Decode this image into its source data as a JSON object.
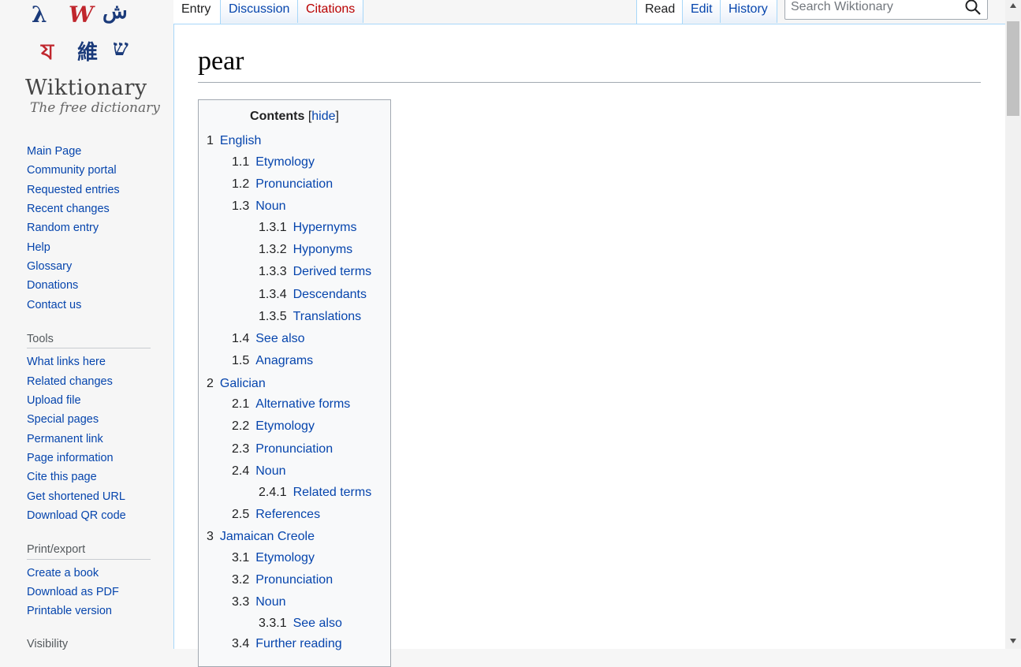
{
  "logo": {
    "glyphs": [
      "λ",
      "W",
      "ش",
      "য",
      "維",
      "ש"
    ],
    "title": "Wiktionary",
    "tagline": "The free dictionary"
  },
  "sidebar": {
    "nav": [
      "Main Page",
      "Community portal",
      "Requested entries",
      "Recent changes",
      "Random entry",
      "Help",
      "Glossary",
      "Donations",
      "Contact us"
    ],
    "tools_heading": "Tools",
    "tools": [
      "What links here",
      "Related changes",
      "Upload file",
      "Special pages",
      "Permanent link",
      "Page information",
      "Cite this page",
      "Get shortened URL",
      "Download QR code"
    ],
    "print_heading": "Print/export",
    "print": [
      "Create a book",
      "Download as PDF",
      "Printable version"
    ],
    "visibility_heading": "Visibility"
  },
  "tabs": {
    "entry": "Entry",
    "discussion": "Discussion",
    "citations": "Citations",
    "read": "Read",
    "edit": "Edit",
    "history": "History"
  },
  "search": {
    "placeholder": "Search Wiktionary"
  },
  "page": {
    "title": "pear"
  },
  "toc": {
    "heading": "Contents",
    "toggle": "hide",
    "entries": [
      {
        "num": "1",
        "text": "English"
      },
      {
        "num": "1.1",
        "text": "Etymology"
      },
      {
        "num": "1.2",
        "text": "Pronunciation"
      },
      {
        "num": "1.3",
        "text": "Noun"
      },
      {
        "num": "1.3.1",
        "text": "Hypernyms"
      },
      {
        "num": "1.3.2",
        "text": "Hyponyms"
      },
      {
        "num": "1.3.3",
        "text": "Derived terms"
      },
      {
        "num": "1.3.4",
        "text": "Descendants"
      },
      {
        "num": "1.3.5",
        "text": "Translations"
      },
      {
        "num": "1.4",
        "text": "See also"
      },
      {
        "num": "1.5",
        "text": "Anagrams"
      },
      {
        "num": "2",
        "text": "Galician"
      },
      {
        "num": "2.1",
        "text": "Alternative forms"
      },
      {
        "num": "2.2",
        "text": "Etymology"
      },
      {
        "num": "2.3",
        "text": "Pronunciation"
      },
      {
        "num": "2.4",
        "text": "Noun"
      },
      {
        "num": "2.4.1",
        "text": "Related terms"
      },
      {
        "num": "2.5",
        "text": "References"
      },
      {
        "num": "3",
        "text": "Jamaican Creole"
      },
      {
        "num": "3.1",
        "text": "Etymology"
      },
      {
        "num": "3.2",
        "text": "Pronunciation"
      },
      {
        "num": "3.3",
        "text": "Noun"
      },
      {
        "num": "3.3.1",
        "text": "See also"
      },
      {
        "num": "3.4",
        "text": "Further reading"
      }
    ]
  },
  "colors": {
    "link": "#0645ad",
    "new_link": "#ba0000",
    "tab_border": "#a7d7f9"
  }
}
